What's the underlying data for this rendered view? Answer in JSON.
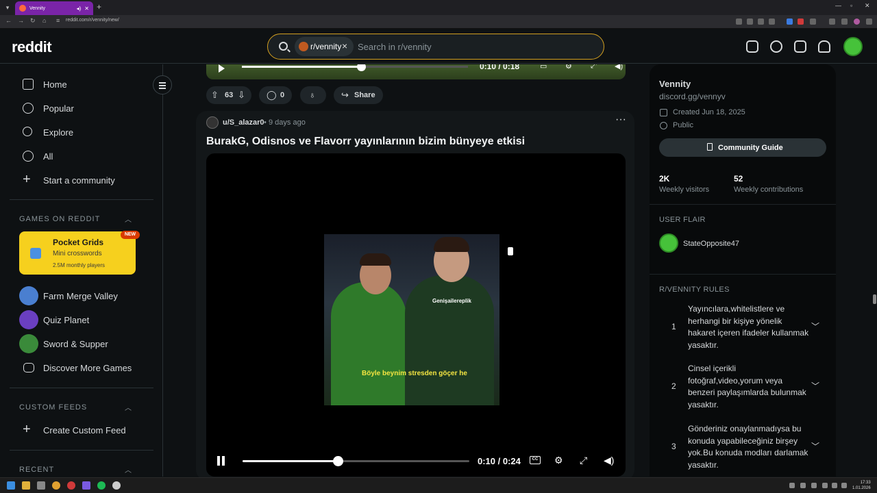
{
  "browser": {
    "tab_title": "Vennity",
    "url": "reddit.com/r/vennity/new/"
  },
  "header": {
    "logo": "reddit",
    "search_chip": "r/vennity",
    "search_placeholder": "Search in r/vennity"
  },
  "sidebar": {
    "nav": [
      {
        "label": "Home",
        "icon": "home-icon"
      },
      {
        "label": "Popular",
        "icon": "popular-icon"
      },
      {
        "label": "Explore",
        "icon": "explore-icon"
      },
      {
        "label": "All",
        "icon": "all-icon"
      },
      {
        "label": "Start a community",
        "icon": "plus-icon"
      }
    ],
    "games_heading": "GAMES ON REDDIT",
    "featured_game": {
      "title": "Pocket Grids",
      "subtitle": "Mini crosswords",
      "players": "2.5M monthly players",
      "badge": "NEW"
    },
    "games": [
      {
        "label": "Farm Merge Valley",
        "color": "#4a7fd0"
      },
      {
        "label": "Quiz Planet",
        "color": "#6a3fc0"
      },
      {
        "label": "Sword & Supper",
        "color": "#3a8a3a"
      },
      {
        "label": "Discover More Games",
        "color": ""
      }
    ],
    "custom_feeds_heading": "CUSTOM FEEDS",
    "create_custom_feed": "Create Custom Feed",
    "recent_heading": "RECENT"
  },
  "prev_post": {
    "time": "0:10 / 0:18",
    "progress": 0.53,
    "votes": "63",
    "comments": "0",
    "share": "Share"
  },
  "post": {
    "user": "u/S_alazar0",
    "dot": "•",
    "age": "9 days ago",
    "title": "BurakG, Odisnos ve Flavorr yayınlarının bizim bünyeye etkisi",
    "video_watermark": "Genişailereplik",
    "video_subtitle": "Böyle beynim stresden göçer he",
    "video_time": "0:10 / 0:24",
    "progress": 0.42,
    "cc_label": "CC"
  },
  "right": {
    "name": "Vennity",
    "link": "discord.gg/vennyv",
    "created": "Created Jun 18, 2025",
    "visibility": "Public",
    "guide_button": "Community Guide",
    "stats": [
      {
        "value": "2K",
        "label": "Weekly visitors"
      },
      {
        "value": "52",
        "label": "Weekly contributions"
      }
    ],
    "user_flair_heading": "USER FLAIR",
    "flair_name": "StateOpposite47",
    "rules_heading": "R/VENNITY RULES",
    "rules": [
      {
        "num": "1",
        "text": "Yayıncılara,whitelistlere ve herhangi bir kişiye yönelik hakaret içeren ifadeler kullanmak yasaktır."
      },
      {
        "num": "2",
        "text": "Cinsel içerikli fotoğraf,video,yorum veya benzeri paylaşımlarda bulunmak yasaktır."
      },
      {
        "num": "3",
        "text": "Gönderiniz onaylanmadıysa bu konuda yapabileceğiniz birşey yok.Bu konuda modları darlamak yasaktır."
      }
    ]
  },
  "taskbar": {
    "time": "17:33",
    "date": "1.01.2026"
  },
  "colors": {
    "accent": "#d4a020",
    "background": "#0e1113",
    "card": "#131719"
  }
}
